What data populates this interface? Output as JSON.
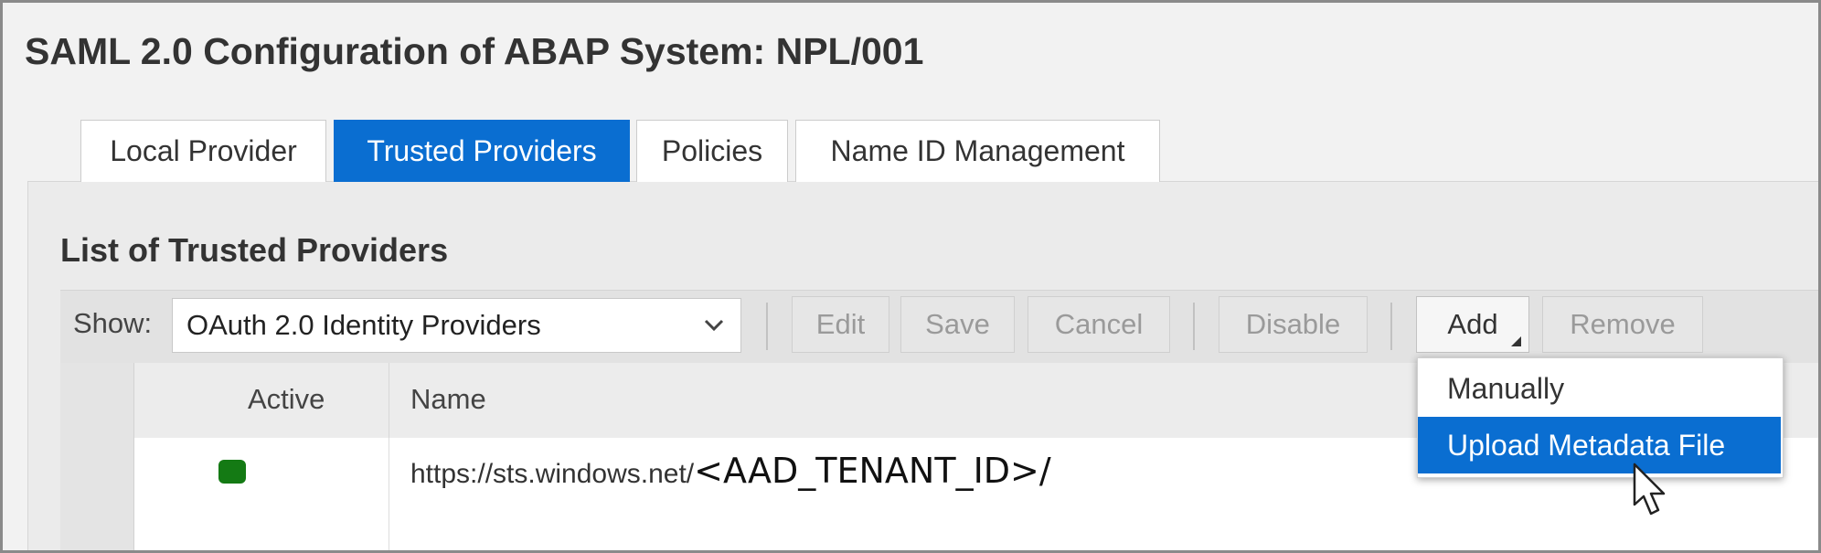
{
  "page_title": "SAML 2.0 Configuration of ABAP System: NPL/001",
  "tabs": [
    {
      "label": "Local Provider",
      "active": false
    },
    {
      "label": "Trusted Providers",
      "active": true
    },
    {
      "label": "Policies",
      "active": false
    },
    {
      "label": "Name ID Management",
      "active": false
    }
  ],
  "section_title": "List of Trusted Providers",
  "toolbar": {
    "show_label": "Show:",
    "show_value": "OAuth 2.0 Identity Providers",
    "buttons": {
      "edit": "Edit",
      "save": "Save",
      "cancel": "Cancel",
      "disable": "Disable",
      "add": "Add",
      "remove": "Remove"
    }
  },
  "table": {
    "columns": [
      "Active",
      "Name"
    ],
    "rows": [
      {
        "active": true,
        "name_prefix": "https://sts.windows.net/",
        "name_suffix": "<AAD_TENANT_ID>/"
      }
    ]
  },
  "add_menu": {
    "items": [
      "Manually",
      "Upload Metadata File"
    ],
    "highlighted_item": "Upload Metadata File"
  },
  "colors": {
    "accent": "#0a6ed1",
    "active_status": "#147a14"
  },
  "icons": [
    "chevron-down-icon",
    "dropdown-triangle-icon",
    "status-active-icon",
    "mouse-pointer-icon"
  ]
}
